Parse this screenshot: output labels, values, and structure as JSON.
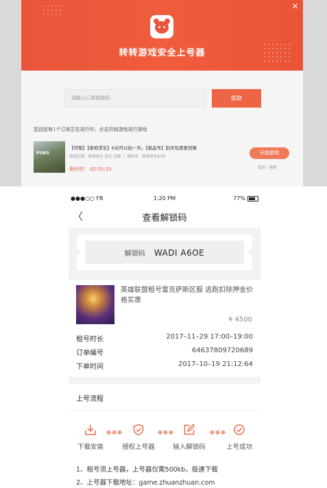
{
  "desktop": {
    "close_label": "×",
    "banner_title": "转转游戏安全上号器",
    "input_placeholder": "请输入订单提取码",
    "extract_button": "提取",
    "notice_prefix": "您目前有",
    "notice_count": "1",
    "notice_suffix": "个订单正在进行中，点击开始游戏进行游戏",
    "game_thumb_text": "PUBG",
    "order_title": "【可租】【绝地求生】6元可以玩一天。【极品号】刮天包度更划算",
    "order_region": "游戏区服：绝地求生-全区-全服",
    "order_role": "角色名：绝地求生80号",
    "countdown": "倒计时： 02:55:25",
    "start_button": "开始游戏",
    "complain_link": "投诉 / 退款"
  },
  "phone": {
    "status": {
      "carrier": "●●●○○ FB",
      "time": "1:20 PM",
      "battery": "77%"
    },
    "nav": {
      "back": "〈",
      "title": "查看解锁码"
    },
    "unlock": {
      "label": "解锁码",
      "code": "WADI A6OE"
    },
    "product": {
      "name": "英雄联盟租号雷克萨斯区服 逃跑扣除押金价格实惠",
      "price": "¥ 4500"
    },
    "details": [
      {
        "key": "租号时长",
        "value": "2017–11–29 17:00–19:00"
      },
      {
        "key": "订单编号",
        "value": "64637809720689"
      },
      {
        "key": "下单时间",
        "value": "2017–10–19 21:12:64"
      }
    ],
    "flow": {
      "title": "上号流程",
      "steps": [
        {
          "label": "下载安装",
          "icon": "download-icon"
        },
        {
          "label": "授权上号器",
          "icon": "shield-check-icon"
        },
        {
          "label": "输入解锁码",
          "icon": "edit-icon"
        },
        {
          "label": "上号成功",
          "icon": "check-circle-icon"
        }
      ],
      "dots": "●●●"
    },
    "notes": [
      "1、租号须上号器，上号器仅需500kb，极速下载",
      "2、上号器下载地址：game.zhuanzhuan.com"
    ]
  },
  "colors": {
    "accent": "#e8553a",
    "step_icon": "#ee6a45"
  }
}
